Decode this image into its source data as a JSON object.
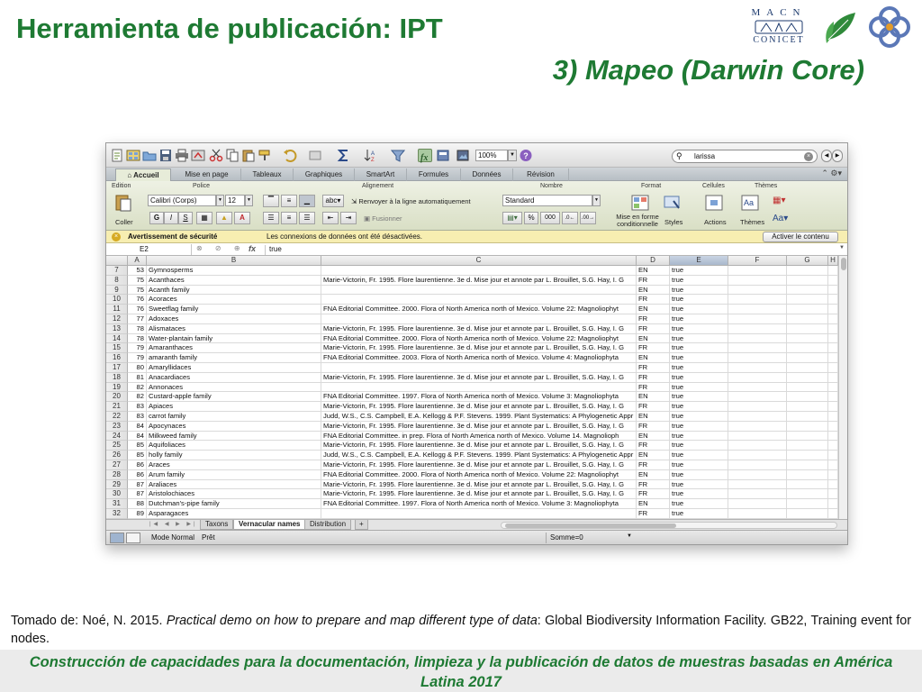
{
  "slide": {
    "title": "Herramienta de publicación: IPT",
    "subtitle": "3) Mapeo (Darwin Core)",
    "logo_macn_top": "MACN",
    "logo_macn_bottom": "CONICET",
    "citation_pre": "Tomado de: Noé, N. 2015. ",
    "citation_italic": "Practical demo on how to prepare and map different type of data",
    "citation_post": ": Global Biodiversity Information Facility. GB22, Training event  for nodes.",
    "footer": "Construcción de capacidades para la documentación, limpieza y la publicación de datos de muestras basadas en América Latina 2017",
    "colors": {
      "title_green": "#1e7a33",
      "footer_bg": "#ebebeb"
    }
  },
  "excel": {
    "zoom": "100%",
    "search_value": "larissa",
    "ribbon_tabs": [
      "Accueil",
      "Mise en page",
      "Tableaux",
      "Graphiques",
      "SmartArt",
      "Formules",
      "Données",
      "Révision"
    ],
    "groups": {
      "edition": "Edition",
      "police": "Police",
      "alignement": "Alignement",
      "nombre": "Nombre",
      "format": "Format",
      "cellules": "Cellules",
      "themes": "Thèmes"
    },
    "font_name": "Calibri (Corps)",
    "font_size": "12",
    "paste_label": "Coller",
    "wrap_label": "Renvoyer à la ligne automatiquement",
    "merge_label": "Fusionner",
    "number_format": "Standard",
    "cond_format_label": "Mise en forme conditionnelle",
    "styles_label": "Styles",
    "actions_label": "Actions",
    "themes_label": "Thèmes",
    "security_title": "Avertissement de sécurité",
    "security_msg": "Les connexions de données ont été désactivées.",
    "security_button": "Activer le contenu",
    "cell_ref": "E2",
    "formula_value": "true",
    "fx": "fx",
    "columns": [
      "A",
      "B",
      "C",
      "D",
      "E",
      "F",
      "G",
      "H"
    ],
    "rows": [
      {
        "r": "7",
        "a": "53",
        "b": "Gymnosperms",
        "c": "",
        "d": "EN",
        "e": "true"
      },
      {
        "r": "8",
        "a": "75",
        "b": "Acanthaces",
        "c": "Marie-Victorin, Fr. 1995. Flore laurentienne. 3e d. Mise  jour et annote par L. Brouillet, S.G. Hay, I. G",
        "d": "FR",
        "e": "true"
      },
      {
        "r": "9",
        "a": "75",
        "b": "Acanth family",
        "c": "",
        "d": "EN",
        "e": "true"
      },
      {
        "r": "10",
        "a": "76",
        "b": "Acoraces",
        "c": "",
        "d": "FR",
        "e": "true"
      },
      {
        "r": "11",
        "a": "76",
        "b": "Sweetflag family",
        "c": "FNA Editorial Committee. 2000. Flora of North America north of Mexico. Volume 22: Magnoliophyt",
        "d": "EN",
        "e": "true"
      },
      {
        "r": "12",
        "a": "77",
        "b": "Adoxaces",
        "c": "",
        "d": "FR",
        "e": "true"
      },
      {
        "r": "13",
        "a": "78",
        "b": "Alismataces",
        "c": "Marie-Victorin, Fr. 1995. Flore laurentienne. 3e d. Mise  jour et annote par L. Brouillet, S.G. Hay, I. G",
        "d": "FR",
        "e": "true"
      },
      {
        "r": "14",
        "a": "78",
        "b": "Water-plantain family",
        "c": "FNA Editorial Committee. 2000. Flora of North America north of Mexico. Volume 22: Magnoliophyt",
        "d": "EN",
        "e": "true"
      },
      {
        "r": "15",
        "a": "79",
        "b": "Amaranthaces",
        "c": "Marie-Victorin, Fr. 1995. Flore laurentienne. 3e d. Mise  jour et annote par L. Brouillet, S.G. Hay, I. G",
        "d": "FR",
        "e": "true"
      },
      {
        "r": "16",
        "a": "79",
        "b": "amaranth family",
        "c": "FNA Editorial Committee. 2003. Flora of North America north of Mexico. Volume 4: Magnoliophyta",
        "d": "EN",
        "e": "true"
      },
      {
        "r": "17",
        "a": "80",
        "b": "Amaryllidaces",
        "c": "",
        "d": "FR",
        "e": "true"
      },
      {
        "r": "18",
        "a": "81",
        "b": "Anacardiaces",
        "c": "Marie-Victorin, Fr. 1995. Flore laurentienne. 3e d. Mise  jour et annote par L. Brouillet, S.G. Hay, I. G",
        "d": "FR",
        "e": "true"
      },
      {
        "r": "19",
        "a": "82",
        "b": "Annonaces",
        "c": "",
        "d": "FR",
        "e": "true"
      },
      {
        "r": "20",
        "a": "82",
        "b": "Custard-apple family",
        "c": "FNA Editorial Committee. 1997. Flora of North America north of Mexico. Volume 3: Magnoliophyta",
        "d": "EN",
        "e": "true"
      },
      {
        "r": "21",
        "a": "83",
        "b": "Apiaces",
        "c": "Marie-Victorin, Fr. 1995. Flore laurentienne. 3e d. Mise  jour et annote par L. Brouillet, S.G. Hay, I. G",
        "d": "FR",
        "e": "true"
      },
      {
        "r": "22",
        "a": "83",
        "b": "carrot family",
        "c": "Judd, W.S., C.S. Campbell, E.A. Kellogg & P.F. Stevens. 1999. Plant Systematics: A Phylogenetic Appr",
        "d": "EN",
        "e": "true"
      },
      {
        "r": "23",
        "a": "84",
        "b": "Apocynaces",
        "c": "Marie-Victorin, Fr. 1995. Flore laurentienne. 3e d. Mise  jour et annote par L. Brouillet, S.G. Hay, I. G",
        "d": "FR",
        "e": "true"
      },
      {
        "r": "24",
        "a": "84",
        "b": "Milkweed family",
        "c": "FNA Editorial Committee. in prep. Flora of North America north of Mexico. Volume 14. Magnolioph",
        "d": "EN",
        "e": "true"
      },
      {
        "r": "25",
        "a": "85",
        "b": "Aquifoliaces",
        "c": "Marie-Victorin, Fr. 1995. Flore laurentienne. 3e d. Mise  jour et annote par L. Brouillet, S.G. Hay, I. G",
        "d": "FR",
        "e": "true"
      },
      {
        "r": "26",
        "a": "85",
        "b": "holly family",
        "c": "Judd, W.S., C.S. Campbell, E.A. Kellogg & P.F. Stevens. 1999. Plant Systematics: A Phylogenetic Appr",
        "d": "EN",
        "e": "true"
      },
      {
        "r": "27",
        "a": "86",
        "b": "Araces",
        "c": "Marie-Victorin, Fr. 1995. Flore laurentienne. 3e d. Mise  jour et annote par L. Brouillet, S.G. Hay, I. G",
        "d": "FR",
        "e": "true"
      },
      {
        "r": "28",
        "a": "86",
        "b": "Arum family",
        "c": "FNA Editorial Committee. 2000. Flora of North America north of Mexico. Volume 22: Magnoliophyt",
        "d": "EN",
        "e": "true"
      },
      {
        "r": "29",
        "a": "87",
        "b": "Araliaces",
        "c": "Marie-Victorin, Fr. 1995. Flore laurentienne. 3e d. Mise  jour et annote par L. Brouillet, S.G. Hay, I. G",
        "d": "FR",
        "e": "true"
      },
      {
        "r": "30",
        "a": "87",
        "b": "Aristolochiaces",
        "c": "Marie-Victorin, Fr. 1995. Flore laurentienne. 3e d. Mise  jour et annote par L. Brouillet, S.G. Hay, I. G",
        "d": "FR",
        "e": "true"
      },
      {
        "r": "31",
        "a": "88",
        "b": "Dutchman's-pipe family",
        "c": "FNA Editorial Committee. 1997. Flora of North America north of Mexico. Volume 3: Magnoliophyta",
        "d": "EN",
        "e": "true"
      },
      {
        "r": "32",
        "a": "89",
        "b": "Asparagaces",
        "c": "",
        "d": "FR",
        "e": "true"
      }
    ],
    "sheet_tabs": [
      "Taxons",
      "Vernacular names",
      "Distribution"
    ],
    "add_sheet": "+",
    "view_mode": "Mode Normal",
    "status": "Prêt",
    "sum": "Somme=0"
  }
}
